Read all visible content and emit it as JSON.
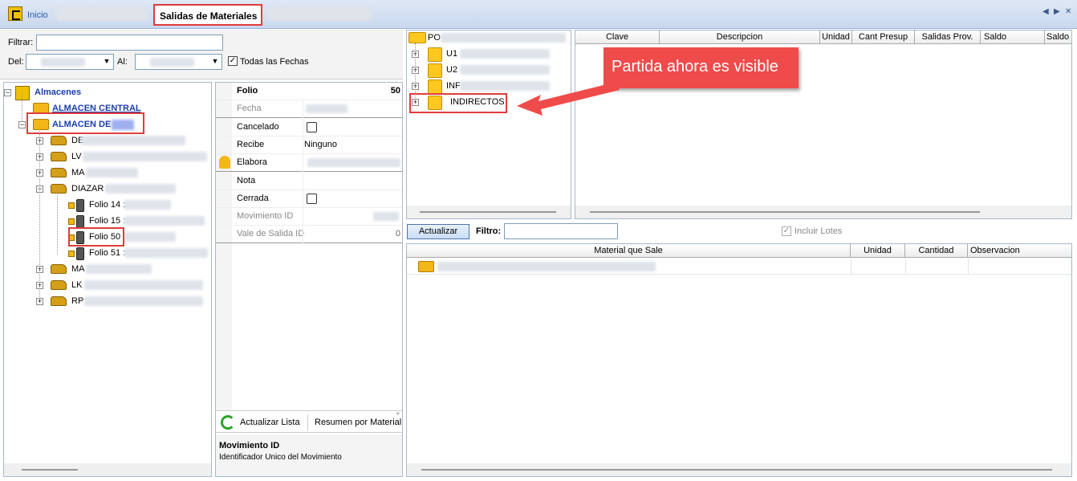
{
  "tabs": {
    "home_label": "Inicio",
    "active_label": "Salidas de Materiales"
  },
  "filter": {
    "filtrar_label": "Filtrar:",
    "del_label": "Del:",
    "al_label": "Al:",
    "todas_fechas_label": "Todas las Fechas",
    "todas_fechas_checked": true
  },
  "tree": {
    "root_label": "Almacenes",
    "almacen_central": "ALMACEN CENTRAL",
    "almacen_de": "ALMACEN DE",
    "nodes": [
      "DE",
      "LV",
      "MA",
      "DIAZAR",
      "MA",
      "LK",
      "RP"
    ],
    "folios": [
      "Folio 14 :",
      "Folio 15 :",
      "Folio 50",
      "Folio 51 :"
    ]
  },
  "props": {
    "rows": [
      {
        "name": "Folio",
        "value": "50"
      },
      {
        "name": "Fecha",
        "value": ""
      },
      {
        "name": "Cancelado",
        "value": ""
      },
      {
        "name": "Recibe",
        "value": "Ninguno"
      },
      {
        "name": "Elabora",
        "value": ""
      },
      {
        "name": "Nota",
        "value": ""
      },
      {
        "name": "Cerrada",
        "value": ""
      },
      {
        "name": "Movimiento ID",
        "value": ""
      },
      {
        "name": "Vale de Salida ID",
        "value": "0"
      }
    ],
    "actualizar_lista": "Actualizar Lista",
    "resumen_material": "Resumen por Material",
    "desc_title": "Movimiento ID",
    "desc_text": "Identificador Unico del Movimiento"
  },
  "partidas": {
    "root": "PO",
    "items": [
      "U1",
      "U2",
      "INF",
      "INDIRECTOS"
    ]
  },
  "grid_top": {
    "columns": [
      "Clave",
      "Descripcion",
      "Unidad",
      "Cant Presup",
      "Salidas Prov.",
      "Saldo",
      "Saldo T"
    ]
  },
  "controls": {
    "actualizar_button": "Actualizar",
    "filtro_label": "Filtro:",
    "incluir_lotes": "Incluir Lotes"
  },
  "grid_bottom": {
    "columns": [
      "Material que Sale",
      "Unidad",
      "Cantidad",
      "Observacion"
    ]
  },
  "annotation": {
    "callout_text": "Partida ahora es visible",
    "color": "#ef4b4b"
  }
}
